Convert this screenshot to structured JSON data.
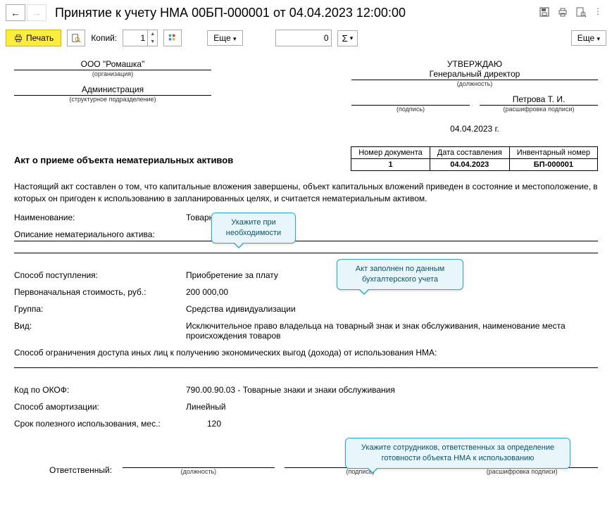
{
  "header": {
    "title": "Принятие к учету НМА 00БП-000001 от 04.04.2023 12:00:00"
  },
  "toolbar": {
    "print_label": "Печать",
    "copies_label": "Копий:",
    "copies_value": "1",
    "more_label": "Еще",
    "zero_value": "0",
    "more2_label": "Еще"
  },
  "approval": {
    "org": "ООО \"Ромашка\"",
    "org_caption": "(организация)",
    "dept": "Администрация",
    "dept_caption": "(структурное подразделение)",
    "approve_title": "УТВЕРЖДАЮ",
    "position": "Генеральный директор",
    "position_caption": "(должность)",
    "sign_caption": "(подпись)",
    "decipher": "Петрова Т. И.",
    "decipher_caption": "(расшифровка подписи)",
    "date": "04.04.2023 г."
  },
  "doc_title": "Акт о приеме объекта нематериальных активов",
  "meta": {
    "h1": "Номер документа",
    "v1": "1",
    "h2": "Дата составления",
    "v2": "04.04.2023",
    "h3": "Инвентарный номер",
    "v3": "БП-000001"
  },
  "body_text": "Настоящий акт составлен о том, что капитальные вложения завершены, объект капитальных вложений приведен в состояние и местоположение, в которых он пригоден к использованию в запланированных целях, и считается нематериальным активом.",
  "fields": {
    "name_label": "Наименование:",
    "name_val": "Товарный знак",
    "desc_label": "Описание нематериального актива:",
    "method_label": "Способ поступления:",
    "method_val": "Приобретение за плату",
    "cost_label": "Первоначальная стоимость, руб.:",
    "cost_val": "200 000,00",
    "group_label": "Группа:",
    "group_val": "Средства идивидуализации",
    "kind_label": "Вид:",
    "kind_val": "Исключительное право владельца на товарный знак и знак обслуживания, наименование места происхождения товаров",
    "restrict_text": "Способ ограничения доступа иных лиц к получению экономических выгод (дохода) от использования НМА:",
    "okof_label": "Код по ОКОФ:",
    "okof_val": "790.00.90.03 - Товарные знаки и знаки обслуживания",
    "amort_label": "Способ амортизации:",
    "amort_val": "Линейный",
    "life_label": "Срок полезного использования, мес.:",
    "life_val": "120"
  },
  "callouts": {
    "c1": "Укажите при необходимости",
    "c2": "Акт заполнен по данным бухгалтерского учета",
    "c3": "Укажите сотрудников, ответственных за определение готовности объекта НМА к использованию"
  },
  "resp": {
    "label": "Ответственный:",
    "pos_caption": "(должность)",
    "sign_caption": "(подпись)",
    "decipher_caption": "(расшифровка подписи)"
  }
}
